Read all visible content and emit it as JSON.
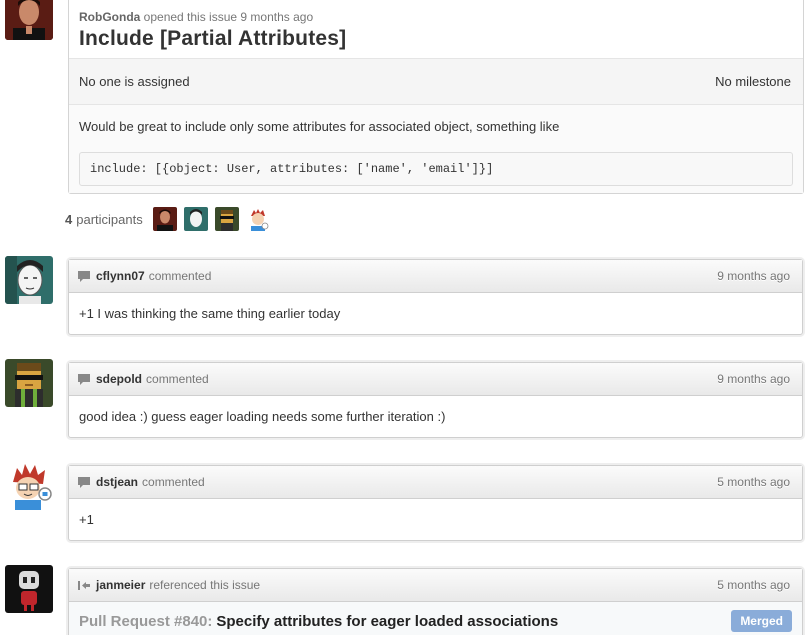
{
  "issue": {
    "author": "RobGonda",
    "action": "opened this issue",
    "time": "9 months ago",
    "title": "Include [Partial Attributes]",
    "assignee": "No one is assigned",
    "milestone": "No milestone",
    "body": "Would be great to include only some attributes for associated object, something like",
    "code": "include: [{object: User, attributes: ['name', 'email']}]"
  },
  "participants": {
    "count": "4",
    "label": "participants"
  },
  "comments": [
    {
      "user": "cflynn07",
      "action": "commented",
      "time": "9 months ago",
      "body": "+1 I was thinking the same thing earlier today"
    },
    {
      "user": "sdepold",
      "action": "commented",
      "time": "9 months ago",
      "body": "good idea :) guess eager loading needs some further iteration :)"
    },
    {
      "user": "dstjean",
      "action": "commented",
      "time": "5 months ago",
      "body": "+1"
    }
  ],
  "reference": {
    "user": "janmeier",
    "action": "referenced this issue",
    "time": "5 months ago",
    "pr_label": "Pull Request #840:",
    "pr_title": "Specify attributes for eager loaded associations",
    "status": "Merged"
  }
}
